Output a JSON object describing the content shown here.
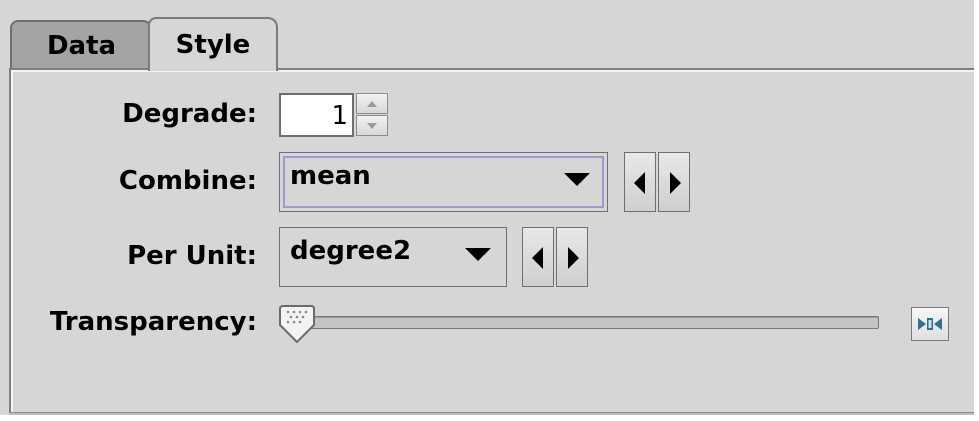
{
  "tabs": [
    {
      "label": "Data",
      "selected": false
    },
    {
      "label": "Style",
      "selected": true
    }
  ],
  "form": {
    "degrade": {
      "label": "Degrade:",
      "value": "1"
    },
    "combine": {
      "label": "Combine:",
      "selected": "mean"
    },
    "per_unit": {
      "label": "Per Unit:",
      "selected": "degree2"
    },
    "transparency": {
      "label": "Transparency:",
      "value_fraction": 0.0
    }
  },
  "icons": {
    "spinner_up": "chevron-up-icon",
    "spinner_down": "chevron-down-icon",
    "combo_arrow": "triangle-down-icon",
    "prev": "triangle-left-icon",
    "next": "triangle-right-icon",
    "reset": "reset-icon"
  },
  "colors": {
    "panel_bg": "#d6d6d6",
    "combo_focus": "#9c9ccc",
    "reset_icon": "#2f6f8f"
  }
}
